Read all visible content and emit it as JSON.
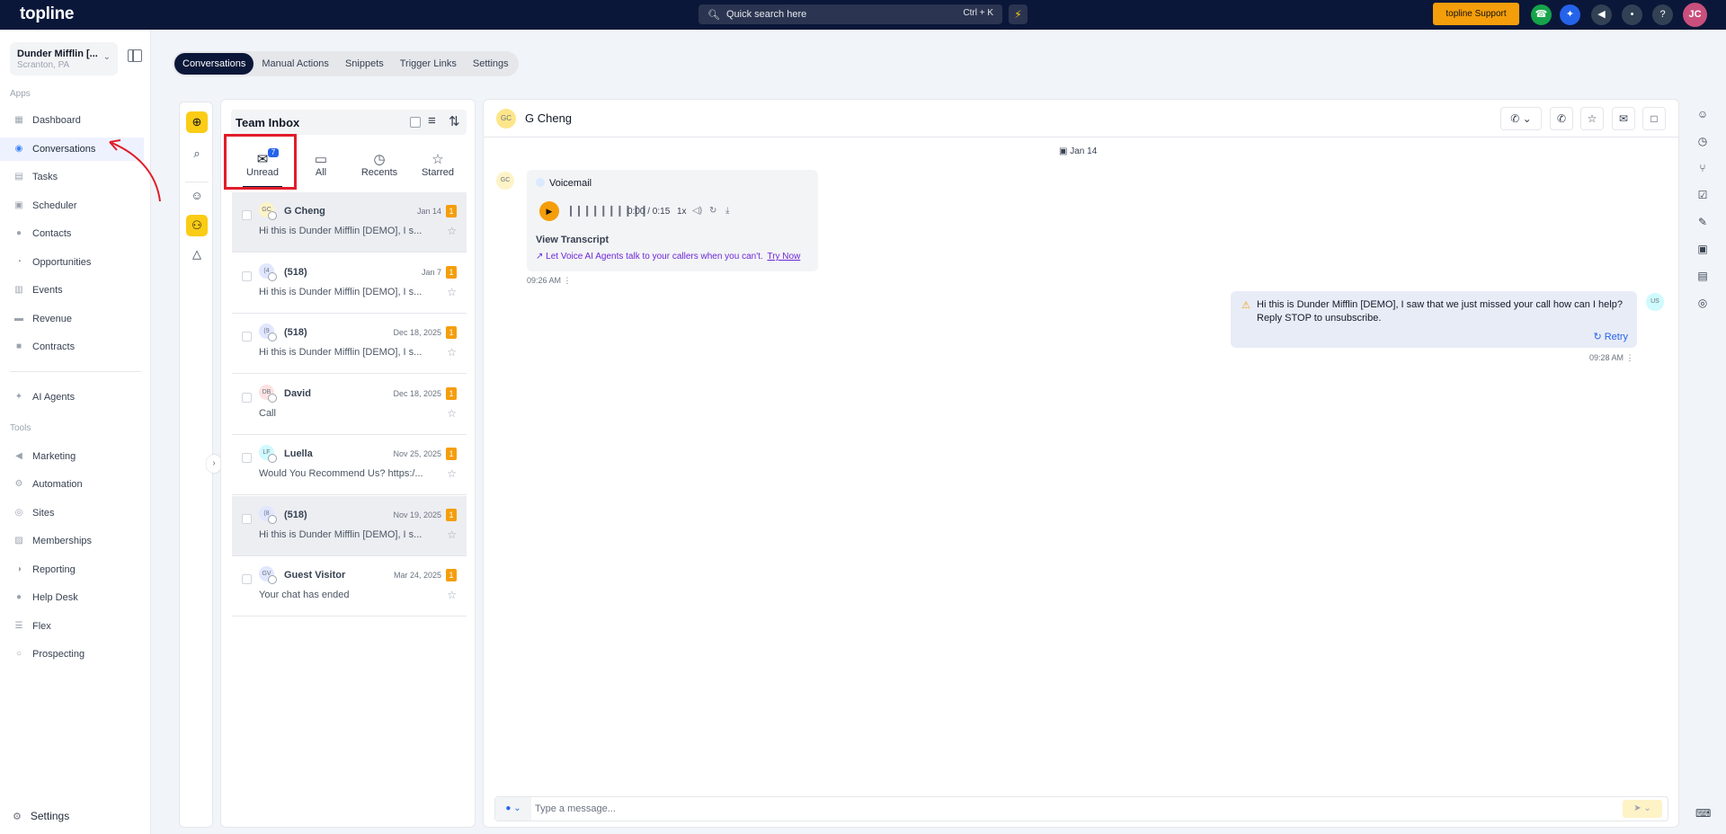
{
  "topbar": {
    "logo": "topline",
    "search_placeholder": "Quick search here",
    "search_shortcut": "Ctrl + K",
    "support_label": "topline Support",
    "user_initials": "JC"
  },
  "sidebar": {
    "location_name": "Dunder Mifflin [...",
    "location_city": "Scranton, PA",
    "apps_label": "Apps",
    "apps": [
      {
        "label": "Dashboard"
      },
      {
        "label": "Conversations"
      },
      {
        "label": "Tasks"
      },
      {
        "label": "Scheduler"
      },
      {
        "label": "Contacts"
      },
      {
        "label": "Opportunities"
      },
      {
        "label": "Events"
      },
      {
        "label": "Revenue"
      },
      {
        "label": "Contracts"
      }
    ],
    "ai_agents": "AI Agents",
    "tools_label": "Tools",
    "tools": [
      {
        "label": "Marketing"
      },
      {
        "label": "Automation"
      },
      {
        "label": "Sites"
      },
      {
        "label": "Memberships"
      },
      {
        "label": "Reporting"
      },
      {
        "label": "Help Desk"
      },
      {
        "label": "Flex"
      },
      {
        "label": "Prospecting"
      }
    ],
    "settings": "Settings"
  },
  "subnav": {
    "tabs": [
      {
        "label": "Conversations"
      },
      {
        "label": "Manual Actions"
      },
      {
        "label": "Snippets"
      },
      {
        "label": "Trigger Links"
      },
      {
        "label": "Settings"
      }
    ]
  },
  "inbox": {
    "title": "Team Inbox",
    "tabs": [
      {
        "label": "Unread",
        "badge": "7"
      },
      {
        "label": "All"
      },
      {
        "label": "Recents"
      },
      {
        "label": "Starred"
      }
    ],
    "conversations": [
      {
        "initials": "GC",
        "name": "G Cheng",
        "date": "Jan 14",
        "count": "1",
        "preview": "Hi this is Dunder Mifflin [DEMO], I s..."
      },
      {
        "initials": "(4",
        "name": "(518)",
        "date": "Jan 7",
        "count": "1",
        "preview": "Hi this is Dunder Mifflin [DEMO], I s..."
      },
      {
        "initials": "(9",
        "name": "(518)",
        "date": "Dec 18, 2025",
        "count": "1",
        "preview": "Hi this is Dunder Mifflin [DEMO], I s..."
      },
      {
        "initials": "DB",
        "name": "David",
        "date": "Dec 18, 2025",
        "count": "1",
        "preview": "Call"
      },
      {
        "initials": "LF",
        "name": "Luella",
        "date": "Nov 25, 2025",
        "count": "1",
        "preview": "Would You Recommend Us? https:/..."
      },
      {
        "initials": "(8",
        "name": "(518)",
        "date": "Nov 19, 2025",
        "count": "1",
        "preview": "Hi this is Dunder Mifflin [DEMO], I s..."
      },
      {
        "initials": "GV",
        "name": "Guest Visitor",
        "date": "Mar 24, 2025",
        "count": "1",
        "preview": "Your chat has ended"
      }
    ]
  },
  "chat": {
    "contact_initials": "GC",
    "contact_name": "G Cheng",
    "date_separator": "Jan 14",
    "voicemail": {
      "label": "Voicemail",
      "time": "0:00 / 0:15",
      "speed": "1x",
      "view_transcript": "View Transcript",
      "promo_text": "Let Voice AI Agents talk to your callers when you can't.",
      "promo_link": "Try Now",
      "timestamp": "09:26 AM"
    },
    "outgoing": {
      "initials": "US",
      "text": "Hi this is Dunder Mifflin [DEMO], I saw that we just missed your call how can I help? Reply STOP to unsubscribe.",
      "retry": "Retry",
      "timestamp": "09:28 AM"
    },
    "composer_placeholder": "Type a message..."
  },
  "colors": {
    "topbar": "#0b1739",
    "accent_yellow": "#facc15",
    "badge_orange": "#f59e0b",
    "annotation_red": "#e11d2a",
    "link_blue": "#2563eb"
  }
}
